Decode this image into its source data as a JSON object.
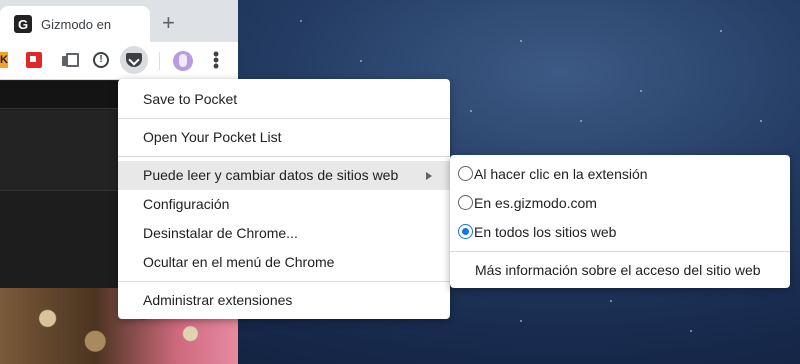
{
  "browser": {
    "tab": {
      "favicon_letter": "G",
      "title": "Gizmodo en E",
      "close_glyph": "×"
    },
    "new_tab_glyph": "+",
    "toolbar": {
      "extension_k_glyph": "K",
      "info_glyph": "!",
      "menu_glyph": "⋮",
      "icons": [
        "keepa-icon",
        "flipboard-icon",
        "copy-icon",
        "info-icon",
        "pocket-icon",
        "profile-avatar",
        "chrome-menu-icon"
      ]
    }
  },
  "context_menu": {
    "items": [
      {
        "label": "Save to Pocket"
      },
      {
        "label": "Open Your Pocket List"
      },
      {
        "label": "Puede leer y cambiar datos de sitios web",
        "has_submenu": true
      },
      {
        "label": "Configuración"
      },
      {
        "label": "Desinstalar de Chrome..."
      },
      {
        "label": "Ocultar en el menú de Chrome"
      },
      {
        "label": "Administrar extensiones"
      }
    ]
  },
  "submenu": {
    "options": [
      {
        "label": "Al hacer clic en la extensión",
        "checked": false
      },
      {
        "label": "En es.gizmodo.com",
        "checked": false
      },
      {
        "label": "En todos los sitios web",
        "checked": true
      }
    ],
    "more_info": "Más información sobre el acceso del sitio web"
  },
  "colors": {
    "accent": "#1a73e8",
    "desktop_bg": "#1e355c",
    "menu_bg": "#ffffff",
    "hover_bg": "#e8e8e9"
  }
}
